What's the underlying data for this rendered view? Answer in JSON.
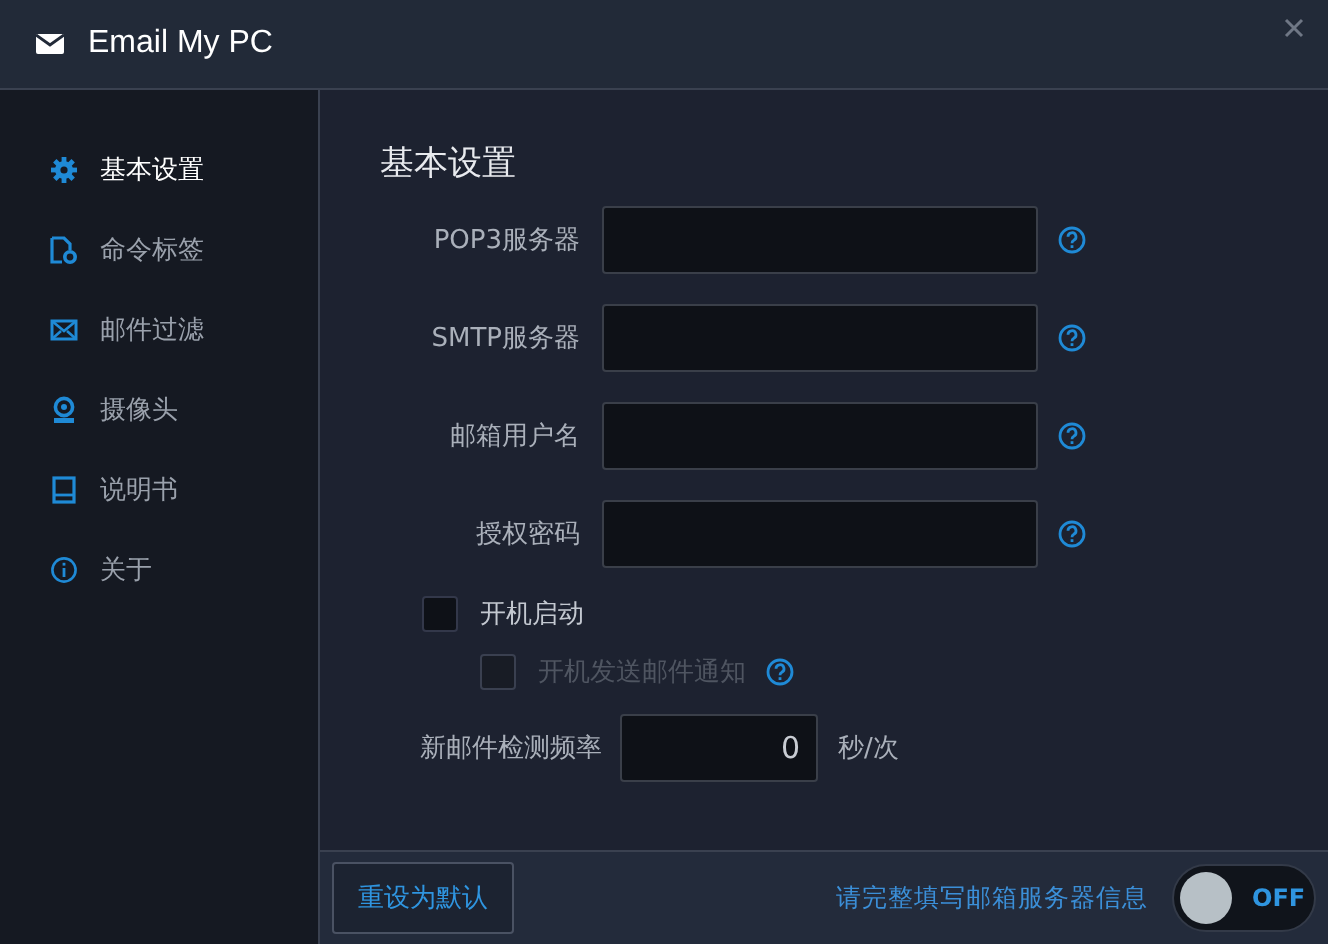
{
  "window": {
    "title": "Email My PC"
  },
  "sidebar": {
    "items": [
      {
        "label": "基本设置",
        "kind": "gear",
        "selected": true
      },
      {
        "label": "命令标签",
        "kind": "doc",
        "selected": false
      },
      {
        "label": "邮件过滤",
        "kind": "mail",
        "selected": false
      },
      {
        "label": "摄像头",
        "kind": "camera",
        "selected": false
      },
      {
        "label": "说明书",
        "kind": "book",
        "selected": false
      },
      {
        "label": "关于",
        "kind": "info",
        "selected": false
      }
    ]
  },
  "section_title": "基本设置",
  "fields": [
    {
      "label": "POP3服务器"
    },
    {
      "label": "SMTP服务器"
    },
    {
      "label": "邮箱用户名"
    },
    {
      "label": "授权密码"
    }
  ],
  "checkboxes": [
    {
      "label": "开机启动",
      "checked": false,
      "disabled": false,
      "kind": "plain"
    },
    {
      "label": "开机发送邮件通知",
      "checked": false,
      "disabled": true,
      "kind": "with_help"
    }
  ],
  "frequency": {
    "label": "新邮件检测频率",
    "value": "0",
    "unit": "秒/次"
  },
  "footer": {
    "reset_button": "重设为默认",
    "status": "请完整填写邮箱服务器信息",
    "switch": {
      "label": "OFF",
      "on": false
    }
  }
}
